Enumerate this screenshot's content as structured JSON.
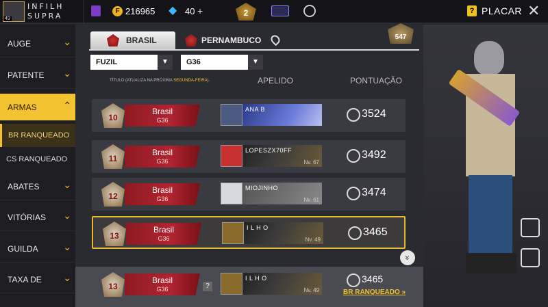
{
  "player": {
    "name_line1": "INFILH",
    "name_line2": "SUPRA",
    "level": "49"
  },
  "currency": {
    "coins": "216965",
    "diamonds": "40",
    "plus": "+"
  },
  "rank_badge": "2",
  "header": {
    "help_icon": "?",
    "title": "PLACAR",
    "close": "✕"
  },
  "sidebar": {
    "items": [
      {
        "label": "AUGE"
      },
      {
        "label": "PATENTE"
      },
      {
        "label": "ARMAS"
      },
      {
        "label": "BR RANQUEADO"
      },
      {
        "label": "CS RANQUEADO"
      },
      {
        "label": "ABATES"
      },
      {
        "label": "VITÓRIAS"
      },
      {
        "label": "GUILDA"
      },
      {
        "label": "TAXA DE"
      }
    ]
  },
  "tabs": {
    "tab1": "BRASIL",
    "tab2": "PERNAMBUCO"
  },
  "medal_count": "547",
  "filters": {
    "weapon_type": "FUZIL",
    "weapon": "G36"
  },
  "columns": {
    "note": "TÍTULO (ATUALIZA NA PRÓXIMA ",
    "note_day": "SEGUNDA-FEIRA",
    "note_end": ").",
    "nickname": "APELIDO",
    "score": "PONTUAÇÃO"
  },
  "rows": [
    {
      "rank": "10",
      "country": "Brasil",
      "weapon": "G36",
      "name": "ANA B",
      "level": "",
      "score": "3524"
    },
    {
      "rank": "11",
      "country": "Brasil",
      "weapon": "G36",
      "name": "LOPESZX70FF",
      "level": "Nv. 67",
      "score": "3492"
    },
    {
      "rank": "12",
      "country": "Brasil",
      "weapon": "G36",
      "name": "MIOJINHO",
      "level": "Nv. 61",
      "score": "3474"
    },
    {
      "rank": "13",
      "country": "Brasil",
      "weapon": "G36",
      "name": "I L H O",
      "level": "Nv. 49",
      "score": "3465"
    }
  ],
  "self_row": {
    "rank": "13",
    "country": "Brasil",
    "weapon": "G36",
    "name": "I L H O",
    "level": "Nv. 49",
    "score": "3465",
    "mode_link": "BR RANQUEADO »",
    "question": "?"
  },
  "scroll_icon": "»"
}
